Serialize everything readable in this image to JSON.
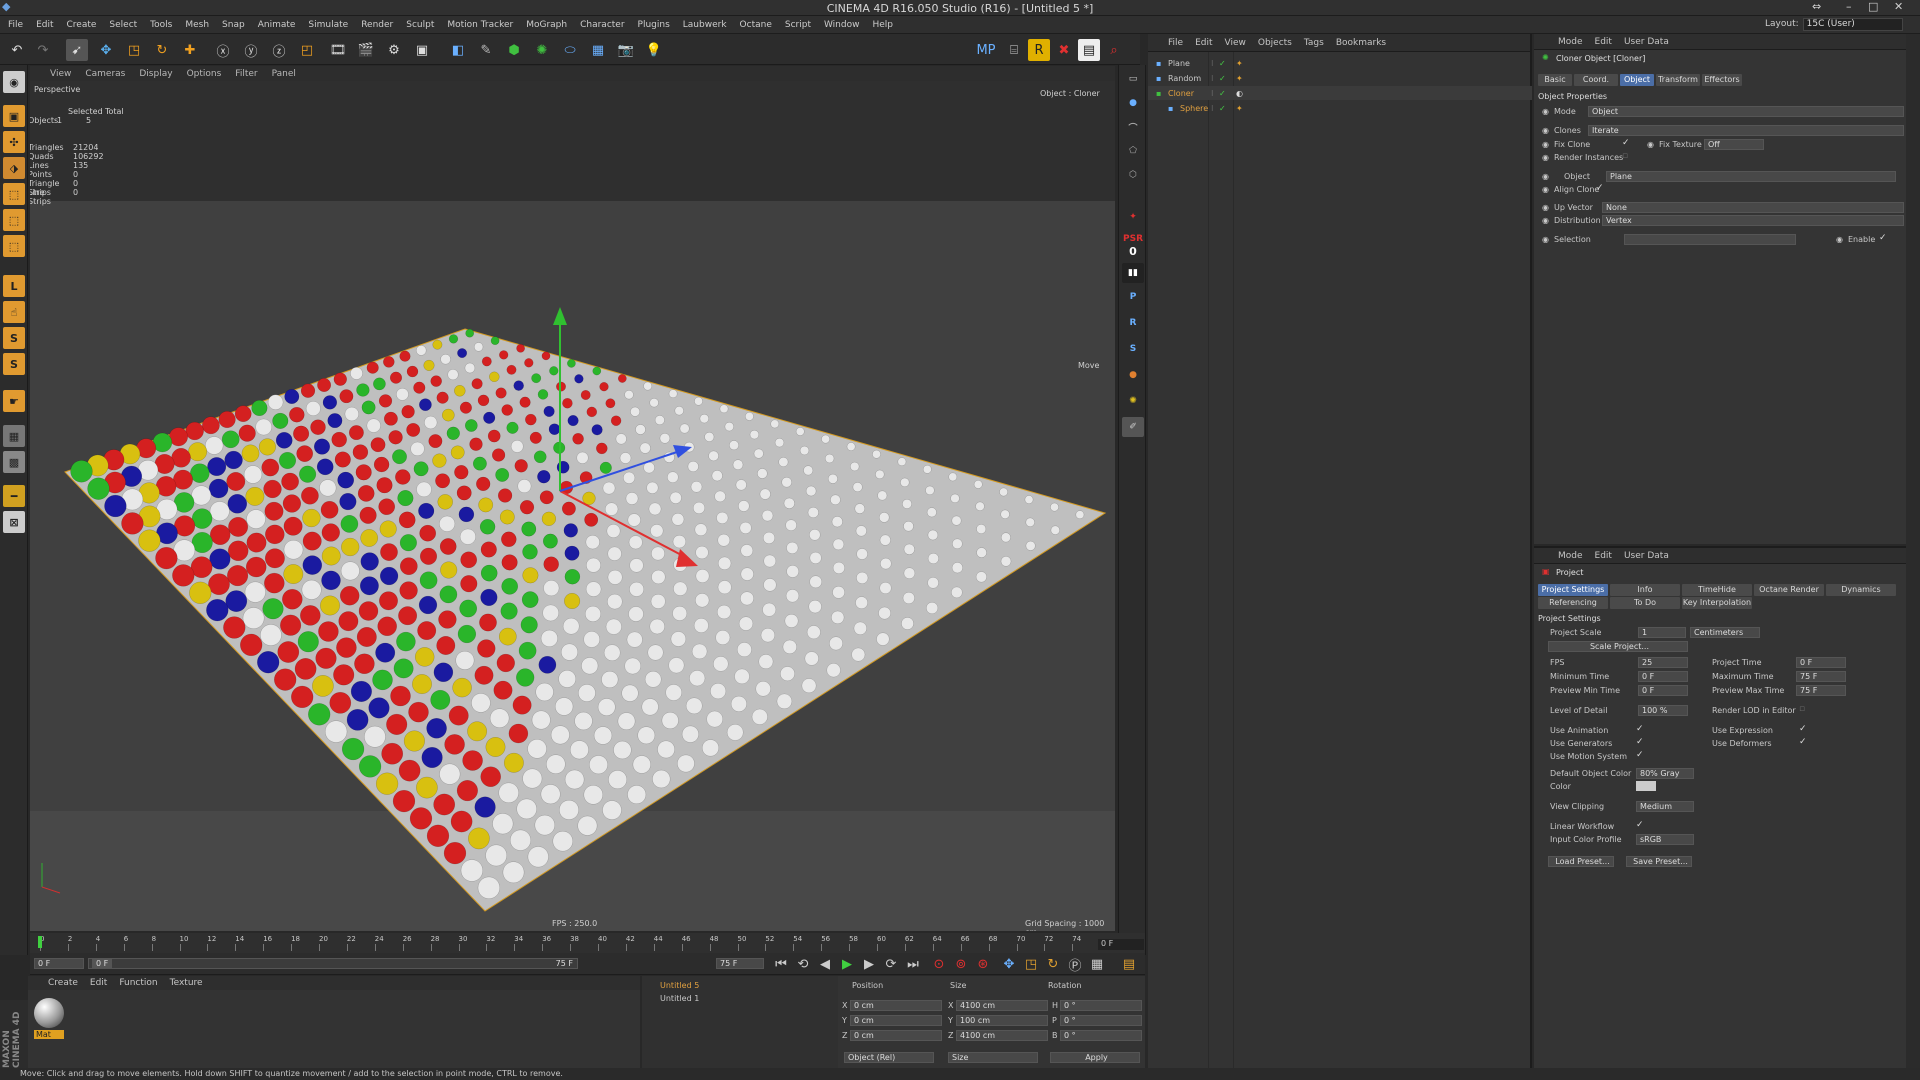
{
  "window": {
    "title": "CINEMA 4D R16.050 Studio (R16) - [Untitled 5 *]"
  },
  "menubar": [
    "File",
    "Edit",
    "Create",
    "Select",
    "Tools",
    "Mesh",
    "Snap",
    "Animate",
    "Simulate",
    "Render",
    "Sculpt",
    "Motion Tracker",
    "MoGraph",
    "Character",
    "Plugins",
    "Laubwerk",
    "Octane",
    "Script",
    "Window",
    "Help"
  ],
  "layout": {
    "label": "Layout:",
    "value": "15C (User)"
  },
  "viewport": {
    "menu": [
      "View",
      "Cameras",
      "Display",
      "Options",
      "Filter",
      "Panel"
    ],
    "name": "Perspective",
    "object_label": "Object : Cloner",
    "move_label": "Move",
    "fps": "FPS : 250.0",
    "grid": "Grid Spacing : 1000 cm",
    "stats": {
      "header_selected": "Selected",
      "header_total": "Total",
      "rows": [
        {
          "label": "Objects",
          "selected": "1",
          "total": "5"
        },
        {
          "label": "Triangles",
          "total": "21204"
        },
        {
          "label": "Quads",
          "total": "106292"
        },
        {
          "label": "Lines",
          "total": "135"
        },
        {
          "label": "Points",
          "total": "0"
        },
        {
          "label": "Triangle Strips",
          "total": "0"
        },
        {
          "label": "Line Strips",
          "total": "0"
        }
      ]
    }
  },
  "right_strip": {
    "psr": "PSR",
    "psr_value": "0"
  },
  "object_manager": {
    "menu": [
      "File",
      "Edit",
      "View",
      "Objects",
      "Tags",
      "Bookmarks"
    ],
    "objects": [
      {
        "name": "Plane",
        "color": "#c8c8c8"
      },
      {
        "name": "Random",
        "color": "#c8c8c8"
      },
      {
        "name": "Cloner",
        "color": "#e0a040"
      },
      {
        "name": "Sphere",
        "color": "#e0a040"
      }
    ]
  },
  "attributes": {
    "menu": [
      "Mode",
      "Edit",
      "User Data"
    ],
    "object_title": "Cloner Object [Cloner]",
    "tabs": [
      "Basic",
      "Coord.",
      "Object",
      "Transform",
      "Effectors"
    ],
    "active_tab": "Object",
    "section": "Object Properties",
    "fields": {
      "mode_label": "Mode",
      "mode_value": "Object",
      "clones_label": "Clones",
      "clones_value": "Iterate",
      "fix_clone_label": "Fix Clone",
      "fix_texture_label": "Fix Texture",
      "fix_texture_value": "Off",
      "render_instances_label": "Render Instances",
      "object_label": "Object",
      "object_value": "Plane",
      "align_clone_label": "Align Clone",
      "up_vector_label": "Up Vector",
      "up_vector_value": "None",
      "distribution_label": "Distribution",
      "distribution_value": "Vertex",
      "selection_label": "Selection",
      "enable_label": "Enable"
    }
  },
  "project": {
    "menu": [
      "Mode",
      "Edit",
      "User Data"
    ],
    "title": "Project",
    "tabs_row1": [
      "Project Settings",
      "Info",
      "TimeHide",
      "Octane Render",
      "Dynamics"
    ],
    "tabs_row2": [
      "Referencing",
      "To Do",
      "Key Interpolation"
    ],
    "active_tab": "Project Settings",
    "section": "Project Settings",
    "project_scale_label": "Project Scale",
    "project_scale_value": "1",
    "project_scale_unit": "Centimeters",
    "scale_project_button": "Scale Project...",
    "fps_label": "FPS",
    "fps_value": "25",
    "project_time_label": "Project Time",
    "project_time_value": "0 F",
    "min_time_label": "Minimum Time",
    "min_time_value": "0 F",
    "max_time_label": "Maximum Time",
    "max_time_value": "75 F",
    "preview_min_label": "Preview Min Time",
    "preview_min_value": "0 F",
    "preview_max_label": "Preview Max Time",
    "preview_max_value": "75 F",
    "lod_label": "Level of Detail",
    "lod_value": "100 %",
    "render_lod_label": "Render LOD in Editor",
    "use_animation": "Use Animation",
    "use_expression": "Use Expression",
    "use_generators": "Use Generators",
    "use_deformers": "Use Deformers",
    "use_motion": "Use Motion System",
    "default_color_label": "Default Object Color",
    "default_color_value": "80% Gray",
    "color_label": "Color",
    "view_clipping_label": "View Clipping",
    "view_clipping_value": "Medium",
    "linear_workflow": "Linear Workflow",
    "input_color_label": "Input Color Profile",
    "input_color_value": "sRGB",
    "load_preset": "Load Preset...",
    "save_preset": "Save Preset..."
  },
  "timeline": {
    "ticks": [
      "0",
      "2",
      "4",
      "6",
      "8",
      "10",
      "12",
      "14",
      "16",
      "18",
      "20",
      "22",
      "24",
      "26",
      "28",
      "30",
      "32",
      "34",
      "36",
      "38",
      "40",
      "42",
      "44",
      "46",
      "48",
      "50",
      "52",
      "54",
      "56",
      "58",
      "60",
      "62",
      "64",
      "66",
      "68",
      "70",
      "72",
      "74"
    ],
    "end_frame": "0 F",
    "current": "0 F",
    "range_start": "0 F",
    "range_end": "75 F",
    "max_field": "75 F"
  },
  "material_manager": {
    "menu": [
      "Create",
      "Edit",
      "Function",
      "Texture"
    ],
    "material_name": "Mat"
  },
  "takes": [
    "Untitled 5",
    "Untitled 1"
  ],
  "coordinates": {
    "headers": [
      "Position",
      "Size",
      "Rotation"
    ],
    "rows": [
      {
        "axis": "X",
        "pos": "0 cm",
        "saxis": "X",
        "size": "4100 cm",
        "raxis": "H",
        "rot": "0 °"
      },
      {
        "axis": "Y",
        "pos": "0 cm",
        "saxis": "Y",
        "size": "100 cm",
        "raxis": "P",
        "rot": "0 °"
      },
      {
        "axis": "Z",
        "pos": "0 cm",
        "saxis": "Z",
        "size": "4100 cm",
        "raxis": "B",
        "rot": "0 °"
      }
    ],
    "mode": "Object (Rel)",
    "size_mode": "Size",
    "apply": "Apply"
  },
  "status": "Move: Click and drag to move elements. Hold down SHIFT to quantize movement / add to the selection in point mode, CTRL to remove.",
  "maxon": "MAXON CINEMA 4D",
  "colors": {
    "accent_blue": "#4b6ea7",
    "active_orange": "#e0a040",
    "red": "#d42020",
    "green": "#2ab52a",
    "blue": "#1a1aa0",
    "yellow": "#d8c010",
    "white": "#e8e8e8"
  }
}
